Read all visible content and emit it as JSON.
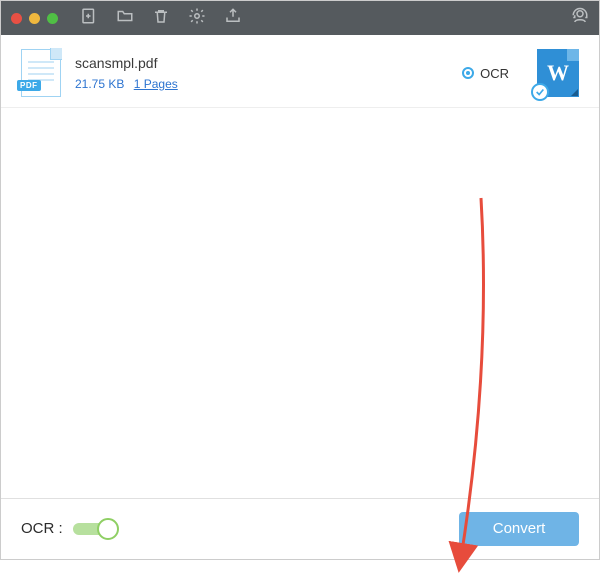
{
  "toolbar": {
    "icons": [
      "add",
      "folder",
      "trash",
      "settings",
      "export"
    ],
    "right_icon": "support"
  },
  "file": {
    "name": "scansmpl.pdf",
    "size": "21.75 KB",
    "pages_label": "1 Pages",
    "type_badge": "PDF",
    "ocr_label": "OCR",
    "ocr_checked": true,
    "target_letter": "W"
  },
  "footer": {
    "ocr_label": "OCR :",
    "ocr_on": true,
    "convert_label": "Convert"
  },
  "colors": {
    "accent": "#3da9e8",
    "convert": "#6fb4e6",
    "switch": "#8fcf64",
    "arrow": "#e74c3c"
  }
}
